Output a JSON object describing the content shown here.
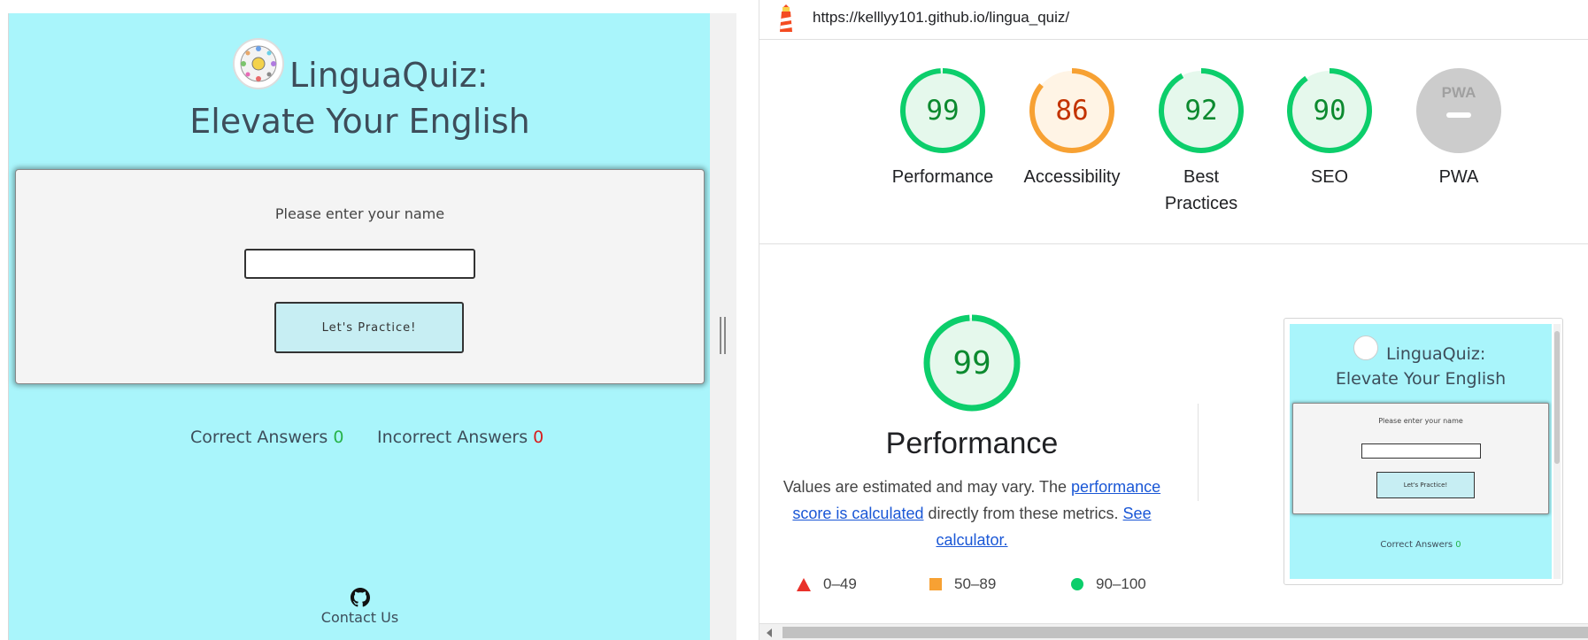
{
  "site": {
    "title_line1": "LinguaQuiz:",
    "title_line2": "Elevate Your English",
    "name_prompt": "Please enter your name",
    "name_input_value": "",
    "practice_button": "Let's Practice!",
    "correct_label": "Correct Answers",
    "correct_value": "0",
    "incorrect_label": "Incorrect Answers",
    "incorrect_value": "0",
    "contact_label": "Contact Us",
    "background_color": "#a9f5fb",
    "icons": [
      "logo-icon",
      "github-icon"
    ]
  },
  "lighthouse": {
    "url": "https://kelllyy101.github.io/lingua_quiz/",
    "scores": [
      {
        "label": "Performance",
        "value": "99",
        "score": 99,
        "status": "pass",
        "color": "#0cce6b",
        "text_color": "#0c8a2f"
      },
      {
        "label": "Accessibility",
        "value": "86",
        "score": 86,
        "status": "average",
        "color": "#f7a133",
        "text_color": "#c33300"
      },
      {
        "label": "Best Practices",
        "value": "92",
        "score": 92,
        "status": "pass",
        "color": "#0cce6b",
        "text_color": "#0c8a2f"
      },
      {
        "label": "SEO",
        "value": "90",
        "score": 90,
        "status": "pass",
        "color": "#0cce6b",
        "text_color": "#0c8a2f"
      },
      {
        "label": "PWA",
        "value": "PWA",
        "score": null,
        "status": "na",
        "color": "#cccccc",
        "text_color": "#a0a0a0"
      }
    ],
    "performance_detail": {
      "score": "99",
      "title": "Performance",
      "desc_prefix": "Values are estimated and may vary. The ",
      "link1": "performance score is calculated",
      "desc_middle": " directly from these metrics. ",
      "link2": "See calculator."
    },
    "legend": [
      {
        "icon": "triangle-icon",
        "range": "0–49",
        "color": "#e9312a"
      },
      {
        "icon": "square-icon",
        "range": "50–89",
        "color": "#f7a133"
      },
      {
        "icon": "circle-icon",
        "range": "90–100",
        "color": "#0cce6b"
      }
    ],
    "thumbnail": {
      "title_line1": "LinguaQuiz:",
      "title_line2": "Elevate Your English",
      "name_prompt": "Please enter your name",
      "button": "Let's Practice!",
      "correct_label": "Correct Answers",
      "correct_value": "0"
    }
  }
}
